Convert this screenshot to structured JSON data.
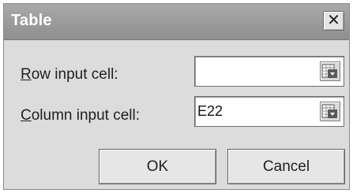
{
  "dialog": {
    "title": "Table",
    "close_glyph": "✕",
    "close_icon": "close-icon"
  },
  "row_input": {
    "label_accel": "R",
    "label_rest": "ow input cell:",
    "value": "",
    "collapse_icon": "collapse-dialog-icon"
  },
  "column_input": {
    "label_accel": "C",
    "label_rest": "olumn input cell:",
    "value": "E22",
    "collapse_icon": "collapse-dialog-icon"
  },
  "buttons": {
    "ok_label": "OK",
    "cancel_label": "Cancel"
  }
}
